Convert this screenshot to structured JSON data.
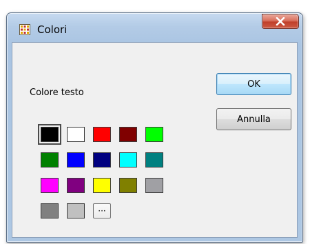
{
  "window": {
    "title": "Colori",
    "icon": "color-grid-icon",
    "close_icon": "close-x-icon"
  },
  "dialog": {
    "label": "Colore testo",
    "ok_label": "OK",
    "cancel_label": "Annulla",
    "more_label": "···",
    "selected_index": 0
  },
  "palette": [
    {
      "name": "black",
      "color": "#000000"
    },
    {
      "name": "white",
      "color": "#ffffff"
    },
    {
      "name": "red",
      "color": "#ff0000"
    },
    {
      "name": "maroon",
      "color": "#800000"
    },
    {
      "name": "lime",
      "color": "#00ff00"
    },
    {
      "name": "green",
      "color": "#008000"
    },
    {
      "name": "blue",
      "color": "#0000ff"
    },
    {
      "name": "navy",
      "color": "#000080"
    },
    {
      "name": "cyan",
      "color": "#00ffff"
    },
    {
      "name": "teal",
      "color": "#008080"
    },
    {
      "name": "magenta",
      "color": "#ff00ff"
    },
    {
      "name": "purple",
      "color": "#800080"
    },
    {
      "name": "yellow",
      "color": "#ffff00"
    },
    {
      "name": "olive",
      "color": "#808000"
    },
    {
      "name": "gray-light",
      "color": "#a0a0a4"
    },
    {
      "name": "gray-dark",
      "color": "#808080"
    },
    {
      "name": "silver",
      "color": "#c0c0c0"
    }
  ]
}
